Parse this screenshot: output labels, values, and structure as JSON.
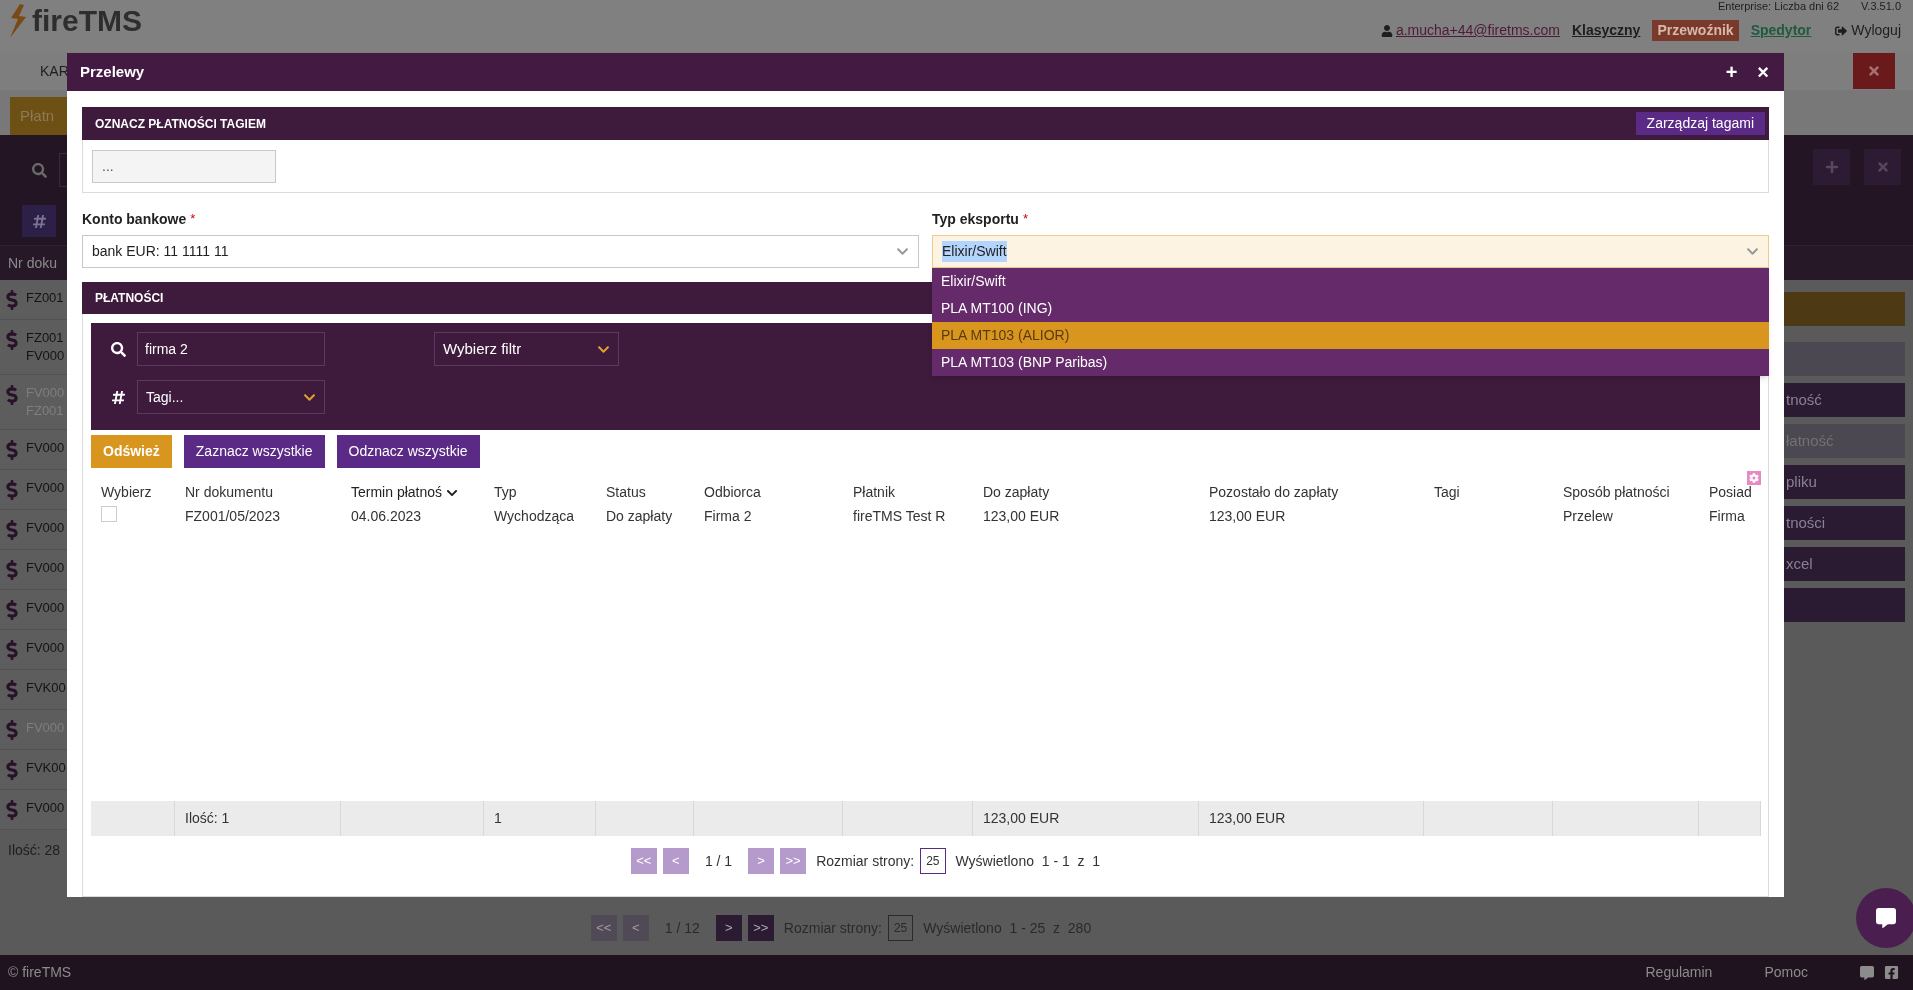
{
  "background": {
    "header": {
      "logo": "fireTMS",
      "edition": "Enterprise: Liczba dni 62",
      "version": "V.3.51.0",
      "user": "a.mucha+44@firetms.com",
      "modes": [
        {
          "label": "Klasyczny",
          "kind": "plain"
        },
        {
          "label": "Przewoźnik",
          "kind": "badge"
        },
        {
          "label": "Spedytor",
          "kind": "link"
        }
      ],
      "logout": "Wyloguj"
    },
    "nav": {
      "item": "KAR"
    },
    "tab": "Płatn",
    "table": {
      "column": "Nr doku",
      "rows": [
        {
          "lines": [
            "FZ001"
          ],
          "dimmed": false
        },
        {
          "lines": [
            "FZ001",
            "FV000"
          ],
          "dimmed": false
        },
        {
          "lines": [
            "FV000",
            "FZ001"
          ],
          "dimmed": true
        },
        {
          "lines": [
            "FV000"
          ],
          "dimmed": false
        },
        {
          "lines": [
            "FV000"
          ],
          "dimmed": false
        },
        {
          "lines": [
            "FV000"
          ],
          "dimmed": false
        },
        {
          "lines": [
            "FV000"
          ],
          "dimmed": false
        },
        {
          "lines": [
            "FV000"
          ],
          "dimmed": false
        },
        {
          "lines": [
            "FV000"
          ],
          "dimmed": false
        },
        {
          "lines": [
            "FVK00"
          ],
          "dimmed": false
        },
        {
          "lines": [
            "FV000"
          ],
          "dimmed": true
        },
        {
          "lines": [
            "FVK00"
          ],
          "dimmed": false
        },
        {
          "lines": [
            "FV000"
          ],
          "dimmed": false
        }
      ],
      "count": "Ilość: 28"
    },
    "pagination": {
      "buttons": [
        {
          "label": "<<",
          "disabled": true
        },
        {
          "label": "<",
          "disabled": true
        },
        {
          "label": ">",
          "disabled": false
        },
        {
          "label": ">>",
          "disabled": false
        }
      ],
      "page": "1 / 12",
      "size_label": "Rozmiar strony:",
      "size": "25",
      "shown": "Wyświetlono  1 - 25  z  280"
    },
    "side_buttons": [
      {
        "kind": "accent"
      },
      {
        "kind": "disabled"
      },
      {
        "kind": "primary",
        "label": "tność"
      },
      {
        "kind": "disabled",
        "label": "łatność"
      },
      {
        "kind": "primary",
        "label": "pliku"
      },
      {
        "kind": "primary",
        "label": "tności"
      },
      {
        "kind": "primary",
        "label": "xcel"
      },
      {
        "kind": "primary"
      }
    ],
    "footer": {
      "copyright": "© fireTMS",
      "links": [
        "Regulamin",
        "Pomoc"
      ]
    }
  },
  "modal": {
    "title": "Przelewy",
    "actions": [
      "+",
      "×"
    ],
    "tag_section": {
      "title": "OZNACZ PŁATNOŚCI TAGIEM",
      "manage_button": "Zarządzaj tagami",
      "placeholder": "..."
    },
    "bank_account": {
      "label": "Konto bankowe",
      "required_mark": "*",
      "value": "bank EUR: 11 1111 11"
    },
    "export_type": {
      "label": "Typ eksportu",
      "required_mark": "*",
      "value": "Elixir/Swift",
      "expanded": true,
      "options": [
        {
          "label": "Elixir/Swift",
          "highlighted": false
        },
        {
          "label": "PLA MT100 (ING)",
          "highlighted": false
        },
        {
          "label": "PLA MT103 (ALIOR)",
          "highlighted": true
        },
        {
          "label": "PLA MT103 (BNP Paribas)",
          "highlighted": false
        }
      ]
    },
    "payments": {
      "title": "PŁATNOŚCI",
      "search": "firma 2",
      "filter": "Wybierz filtr",
      "tags": "Tagi...",
      "buttons": [
        {
          "label": "Odśwież",
          "kind": "accent"
        },
        {
          "label": "Zaznacz wszystkie",
          "kind": "primary"
        },
        {
          "label": "Odznacz wszystkie",
          "kind": "primary"
        }
      ],
      "table": {
        "columns": [
          {
            "label": "Wybierz",
            "sorted": false
          },
          {
            "label": "Nr dokumentu",
            "sorted": false
          },
          {
            "label": "Termin płatnoś",
            "sorted": true
          },
          {
            "label": "Typ",
            "sorted": false
          },
          {
            "label": "Status",
            "sorted": false
          },
          {
            "label": "Odbiorca",
            "sorted": false
          },
          {
            "label": "Płatnik",
            "sorted": false
          },
          {
            "label": "Do zapłaty",
            "sorted": false
          },
          {
            "label": "Pozostało do zapłaty",
            "sorted": false
          },
          {
            "label": "Tagi",
            "sorted": false
          },
          {
            "label": "Sposób płatności",
            "sorted": false
          },
          {
            "label": "Posiad",
            "sorted": false
          }
        ],
        "rows": [
          {
            "cells": [
              {
                "kind": "checkbox",
                "checked": false
              },
              {
                "kind": "text",
                "text": "FZ001/05/2023"
              },
              {
                "kind": "text",
                "text": "04.06.2023"
              },
              {
                "kind": "text",
                "text": "Wychodząca"
              },
              {
                "kind": "text",
                "text": "Do zapłaty"
              },
              {
                "kind": "text",
                "text": "Firma 2"
              },
              {
                "kind": "text",
                "text": "fireTMS Test R"
              },
              {
                "kind": "text",
                "text": "123,00 EUR"
              },
              {
                "kind": "text",
                "text": "123,00 EUR"
              },
              {
                "kind": "empty"
              },
              {
                "kind": "text",
                "text": "Przelew"
              },
              {
                "kind": "text",
                "text": "Firma"
              }
            ]
          }
        ],
        "summary": [
          {
            "kind": "empty"
          },
          {
            "kind": "text",
            "text": "Ilość: 1"
          },
          {
            "kind": "empty"
          },
          {
            "kind": "text",
            "text": "1"
          },
          {
            "kind": "empty"
          },
          {
            "kind": "empty"
          },
          {
            "kind": "empty"
          },
          {
            "kind": "text",
            "text": "123,00 EUR"
          },
          {
            "kind": "text",
            "text": "123,00 EUR"
          },
          {
            "kind": "empty"
          },
          {
            "kind": "empty"
          },
          {
            "kind": "empty"
          }
        ]
      },
      "pagination": {
        "buttons": [
          {
            "label": "<<",
            "disabled": true
          },
          {
            "label": "<",
            "disabled": true
          },
          {
            "label": ">",
            "disabled": true
          },
          {
            "label": ">>",
            "disabled": true
          }
        ],
        "page": "1 / 1",
        "size_label": "Rozmiar strony:",
        "size": "25",
        "shown": "Wyświetlono  1 - 1  z  1"
      }
    }
  }
}
